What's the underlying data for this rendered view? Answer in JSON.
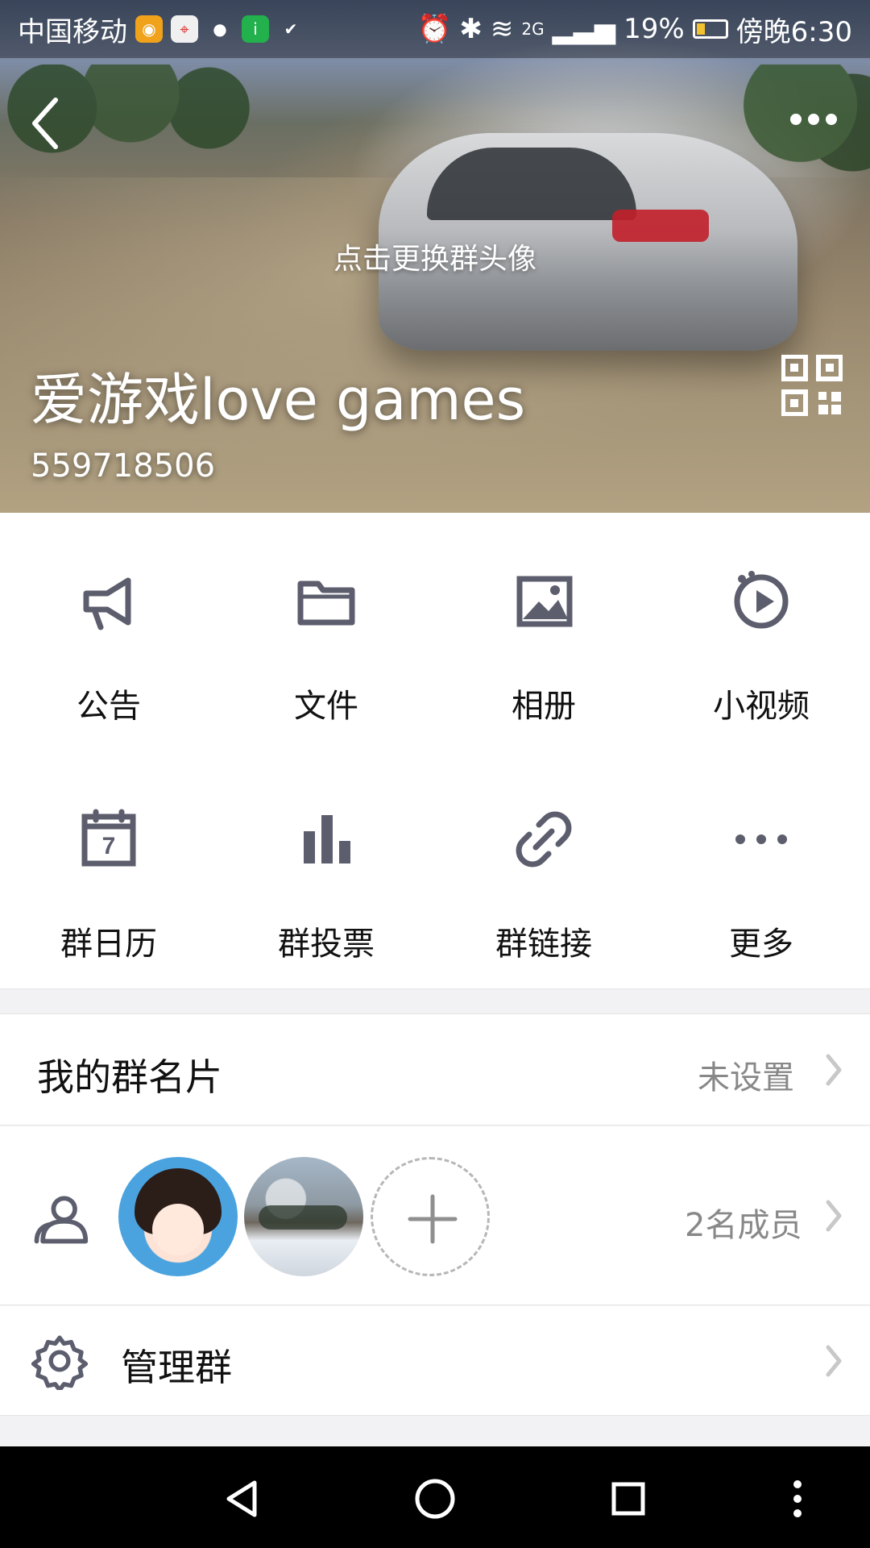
{
  "status_bar": {
    "carrier": "中国移动",
    "battery": "19%",
    "network": "2G",
    "time": "傍晚6:30",
    "apps": [
      "weibo-icon",
      "maps-icon",
      "chat-bubble-icon",
      "iqiyi-icon",
      "shield-check-icon"
    ]
  },
  "header": {
    "change_avatar_text": "点击更换群头像",
    "group_name": "爱游戏love games",
    "group_id": "559718506",
    "icons": {
      "back": "back-chevron-icon",
      "more": "more-dots-icon",
      "qr": "qr-code-icon"
    }
  },
  "functions": [
    {
      "label": "公告",
      "icon": "megaphone-icon"
    },
    {
      "label": "文件",
      "icon": "folder-icon"
    },
    {
      "label": "相册",
      "icon": "album-icon"
    },
    {
      "label": "小视频",
      "icon": "video-play-icon"
    },
    {
      "label": "群日历",
      "icon": "calendar-icon",
      "calendar_day": "7"
    },
    {
      "label": "群投票",
      "icon": "poll-bars-icon"
    },
    {
      "label": "群链接",
      "icon": "link-icon"
    },
    {
      "label": "更多",
      "icon": "more-dots-icon"
    }
  ],
  "rows": {
    "my_card": {
      "label": "我的群名片",
      "value": "未设置"
    },
    "members": {
      "count_text": "2名成员",
      "icon": "members-icon"
    },
    "manage": {
      "label": "管理群",
      "icon": "gear-icon"
    }
  },
  "nav": {
    "icons": [
      "nav-back-icon",
      "nav-home-icon",
      "nav-recents-icon",
      "nav-menu-icon"
    ]
  },
  "colors": {
    "icon_gray": "#5c5e6e",
    "text": "#111111",
    "muted": "#888888",
    "bg": "#f2f2f4"
  }
}
